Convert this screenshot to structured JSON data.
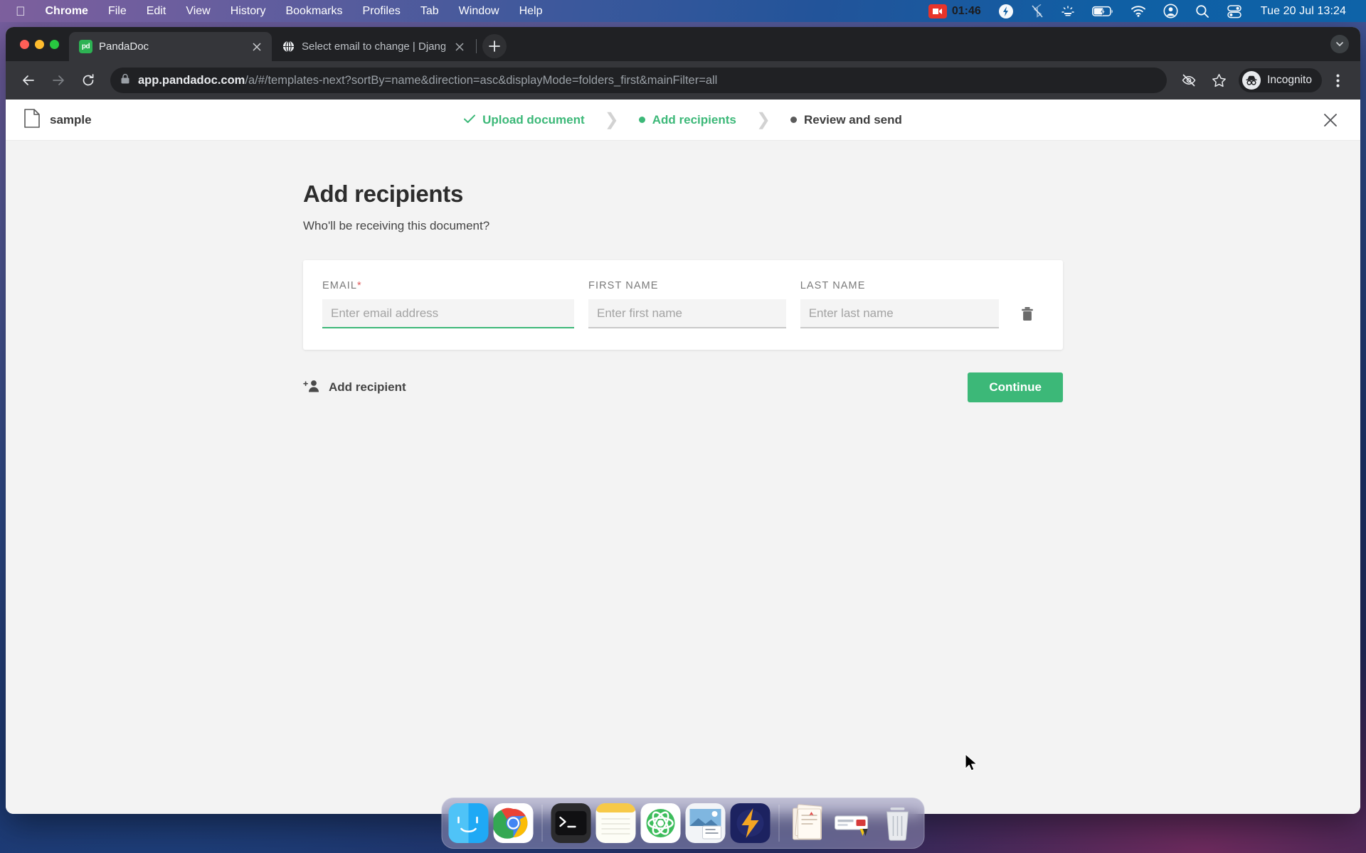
{
  "menubar": {
    "apple_icon": "apple-logo-icon",
    "items": [
      {
        "label": "Chrome",
        "bold": true
      },
      {
        "label": "File",
        "bold": false
      },
      {
        "label": "Edit",
        "bold": false
      },
      {
        "label": "View",
        "bold": false
      },
      {
        "label": "History",
        "bold": false
      },
      {
        "label": "Bookmarks",
        "bold": false
      },
      {
        "label": "Profiles",
        "bold": false
      },
      {
        "label": "Tab",
        "bold": false
      },
      {
        "label": "Window",
        "bold": false
      },
      {
        "label": "Help",
        "bold": false
      }
    ],
    "recording_time": "01:46",
    "status_icons": [
      "screen-recording-icon",
      "flash-bolt-icon",
      "bluetooth-off-icon",
      "brightness-icon",
      "battery-charging-icon",
      "wifi-icon",
      "user-account-icon",
      "spotlight-search-icon",
      "control-center-icon"
    ],
    "clock": "Tue 20 Jul  13:24"
  },
  "browser": {
    "tabs": [
      {
        "title": "PandaDoc",
        "favicon": "pandadoc-favicon",
        "active": true
      },
      {
        "title": "Select email to change | Djang",
        "favicon": "globe-icon",
        "active": false
      }
    ],
    "new_tab_label": "+",
    "toolbar": {
      "back_icon": "back-arrow-icon",
      "forward_icon": "forward-arrow-icon",
      "reload_icon": "reload-icon",
      "lock_icon": "lock-icon",
      "url_host": "app.pandadoc.com",
      "url_path": "/a/#/templates-next?sortBy=name&direction=asc&displayMode=folders_first&mainFilter=all",
      "eye_slash_icon": "eye-slash-icon",
      "bookmark_icon": "star-bookmark-icon",
      "profile_label": "Incognito",
      "profile_icon": "incognito-icon",
      "menu_icon": "three-dot-menu-icon"
    }
  },
  "app": {
    "header": {
      "doc_icon": "document-icon",
      "doc_name": "sample",
      "close_icon": "close-icon",
      "steps": [
        {
          "label": "Upload document",
          "state": "done",
          "marker": "check-icon"
        },
        {
          "label": "Add recipients",
          "state": "active",
          "marker": "dot-icon"
        },
        {
          "label": "Review and send",
          "state": "todo",
          "marker": "dot-icon"
        }
      ],
      "separator": "❯"
    },
    "main": {
      "title": "Add recipients",
      "subtitle": "Who'll be receiving this document?",
      "recipient": {
        "email": {
          "label": "EMAIL",
          "required_mark": "*",
          "value": "",
          "placeholder": "Enter email address"
        },
        "first_name": {
          "label": "FIRST NAME",
          "value": "",
          "placeholder": "Enter first name"
        },
        "last_name": {
          "label": "LAST NAME",
          "value": "",
          "placeholder": "Enter last name"
        },
        "delete_icon": "trash-icon"
      },
      "add_recipient_label": "Add recipient",
      "add_recipient_icon": "add-person-icon",
      "continue_label": "Continue"
    },
    "colors": {
      "accent_green": "#3cb878",
      "page_background": "#f3f3f3",
      "card_background": "#ffffff",
      "required_red": "#e05a5a"
    }
  },
  "dock": {
    "items": [
      {
        "name": "finder"
      },
      {
        "name": "google-chrome"
      },
      {
        "name": "terminal"
      },
      {
        "name": "notes"
      },
      {
        "name": "atom"
      },
      {
        "name": "preview"
      },
      {
        "name": "thunder-client"
      },
      {
        "name": "documents-folder"
      },
      {
        "name": "downloads-stack"
      },
      {
        "name": "trash"
      }
    ]
  }
}
